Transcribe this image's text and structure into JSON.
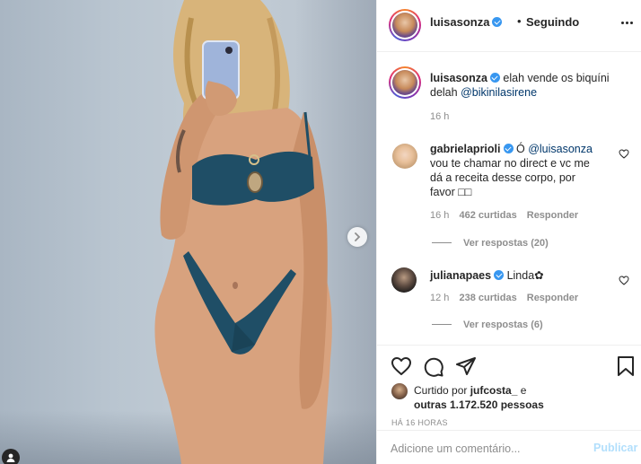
{
  "post": {
    "author": "luisasonza",
    "follow_status": "Seguindo",
    "separator": "•",
    "caption": {
      "text": "elah vende os biquíni delah",
      "mention": "@bikinilasirene",
      "time": "16 h"
    },
    "comments": [
      {
        "user": "gabrielaprioli",
        "verified": true,
        "text_prefix": "Ó",
        "mention": "@luisasonza",
        "text": "vou te chamar no direct e vc me dá a receita desse corpo, por favor □□",
        "time": "16 h",
        "likes": "462 curtidas",
        "reply_label": "Responder",
        "view_replies": "Ver respostas (20)"
      },
      {
        "user": "julianapaes",
        "verified": true,
        "text": "Linda✿",
        "time": "12 h",
        "likes": "238 curtidas",
        "reply_label": "Responder",
        "view_replies": "Ver respostas (6)"
      }
    ],
    "actions": {
      "icons": [
        "heart-icon",
        "comment-icon",
        "share-icon",
        "bookmark-icon"
      ]
    },
    "liked_by": {
      "prefix": "Curtido por",
      "user": "jufcosta_",
      "middle": "e",
      "others": "outras 1.172.520 pessoas"
    },
    "time_ago": "HÁ 16 HORAS",
    "add_comment": {
      "placeholder": "Adicione um comentário...",
      "publish_label": "Publicar"
    }
  },
  "colors": {
    "verified": "#3897f0",
    "mention": "#00376b",
    "muted": "#8e8e8e",
    "publish_disabled": "#b2dffc"
  }
}
